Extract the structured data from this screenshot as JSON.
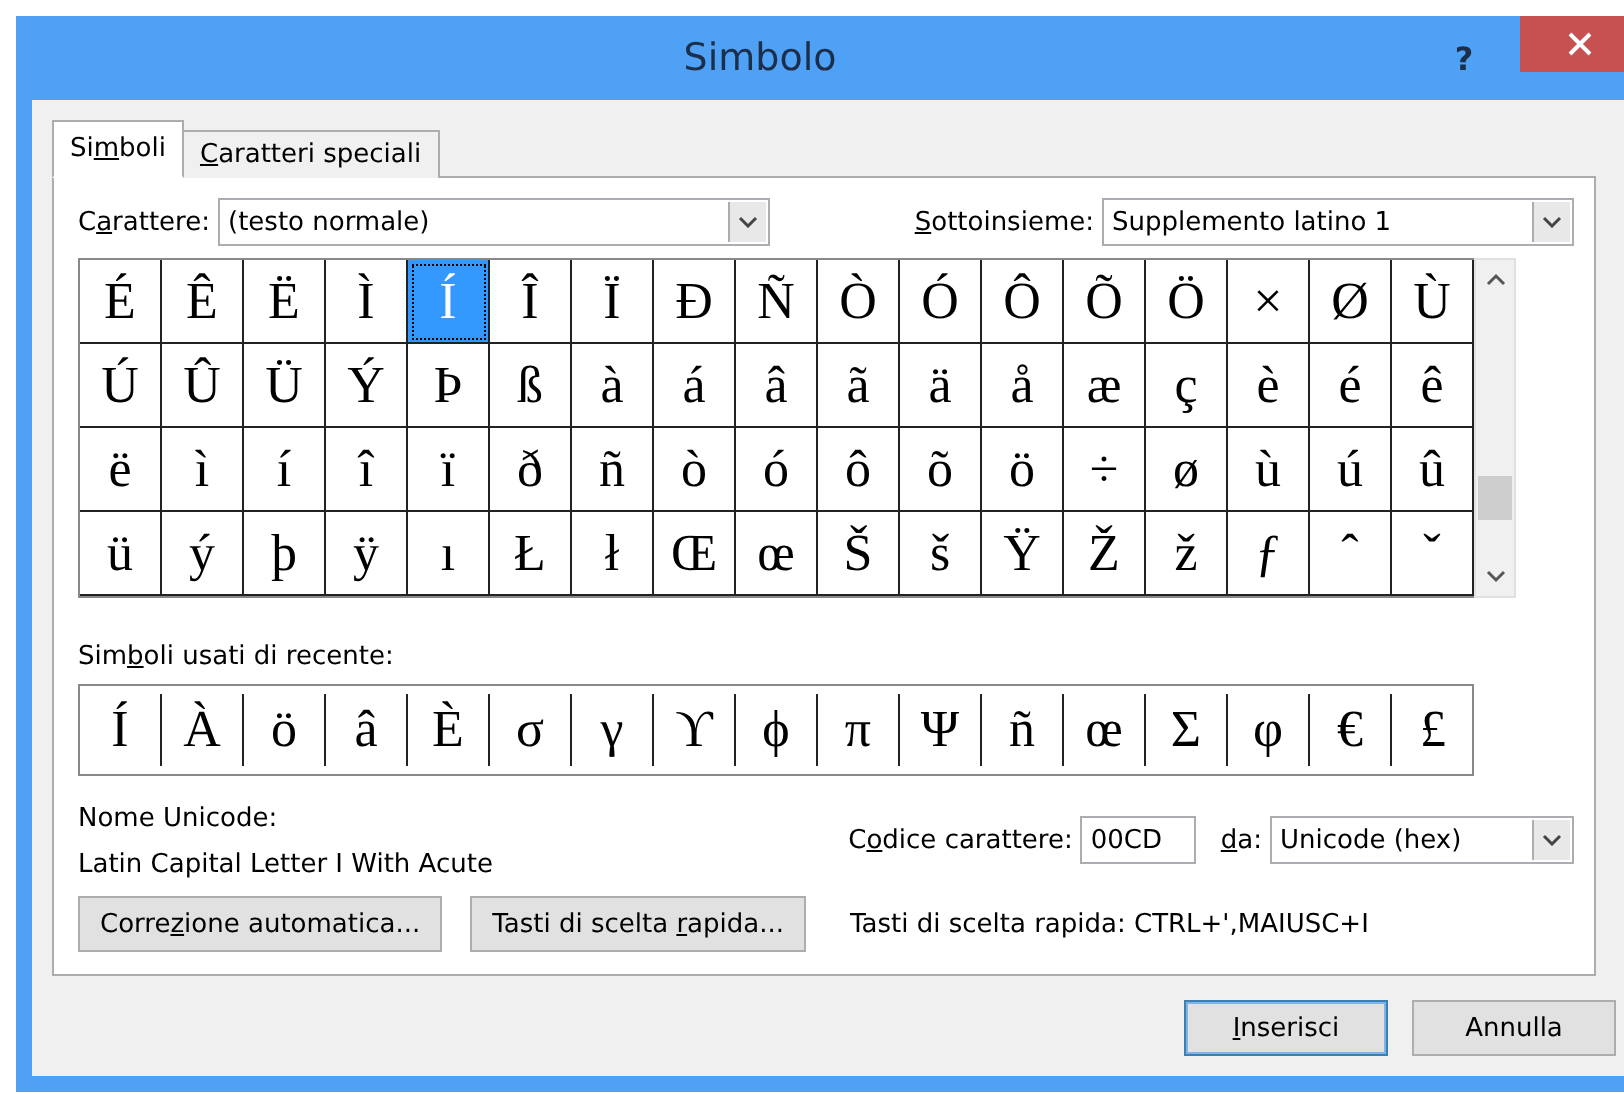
{
  "window": {
    "title": "Simbolo",
    "help_button": "?"
  },
  "tabs": [
    {
      "label": {
        "pre": "Si",
        "key": "m",
        "post": "boli"
      },
      "selected": true
    },
    {
      "label": {
        "key": "C",
        "post": "aratteri speciali"
      },
      "selected": false
    }
  ],
  "font_field": {
    "label": {
      "pre": "C",
      "key": "a",
      "post": "rattere:"
    },
    "value": "(testo normale)"
  },
  "subset_field": {
    "label": {
      "key": "S",
      "post": "ottoinsieme:"
    },
    "value": "Supplemento latino 1"
  },
  "symbol_grid": [
    [
      {
        "char": "É",
        "selected": false
      },
      {
        "char": "Ê",
        "selected": false
      },
      {
        "char": "Ë",
        "selected": false
      },
      {
        "char": "Ì",
        "selected": false
      },
      {
        "char": "Í",
        "selected": true
      },
      {
        "char": "Î",
        "selected": false
      },
      {
        "char": "Ï",
        "selected": false
      },
      {
        "char": "Ð",
        "selected": false
      },
      {
        "char": "Ñ",
        "selected": false
      },
      {
        "char": "Ò",
        "selected": false
      },
      {
        "char": "Ó",
        "selected": false
      },
      {
        "char": "Ô",
        "selected": false
      },
      {
        "char": "Õ",
        "selected": false
      },
      {
        "char": "Ö",
        "selected": false
      },
      {
        "char": "×",
        "selected": false
      },
      {
        "char": "Ø",
        "selected": false
      },
      {
        "char": "Ù",
        "selected": false
      }
    ],
    [
      {
        "char": "Ú",
        "selected": false
      },
      {
        "char": "Û",
        "selected": false
      },
      {
        "char": "Ü",
        "selected": false
      },
      {
        "char": "Ý",
        "selected": false
      },
      {
        "char": "Þ",
        "selected": false
      },
      {
        "char": "ß",
        "selected": false
      },
      {
        "char": "à",
        "selected": false
      },
      {
        "char": "á",
        "selected": false
      },
      {
        "char": "â",
        "selected": false
      },
      {
        "char": "ã",
        "selected": false
      },
      {
        "char": "ä",
        "selected": false
      },
      {
        "char": "å",
        "selected": false
      },
      {
        "char": "æ",
        "selected": false
      },
      {
        "char": "ç",
        "selected": false
      },
      {
        "char": "è",
        "selected": false
      },
      {
        "char": "é",
        "selected": false
      },
      {
        "char": "ê",
        "selected": false
      }
    ],
    [
      {
        "char": "ë",
        "selected": false
      },
      {
        "char": "ì",
        "selected": false
      },
      {
        "char": "í",
        "selected": false
      },
      {
        "char": "î",
        "selected": false
      },
      {
        "char": "ï",
        "selected": false
      },
      {
        "char": "ð",
        "selected": false
      },
      {
        "char": "ñ",
        "selected": false
      },
      {
        "char": "ò",
        "selected": false
      },
      {
        "char": "ó",
        "selected": false
      },
      {
        "char": "ô",
        "selected": false
      },
      {
        "char": "õ",
        "selected": false
      },
      {
        "char": "ö",
        "selected": false
      },
      {
        "char": "÷",
        "selected": false
      },
      {
        "char": "ø",
        "selected": false
      },
      {
        "char": "ù",
        "selected": false
      },
      {
        "char": "ú",
        "selected": false
      },
      {
        "char": "û",
        "selected": false
      }
    ],
    [
      {
        "char": "ü",
        "selected": false
      },
      {
        "char": "ý",
        "selected": false
      },
      {
        "char": "þ",
        "selected": false
      },
      {
        "char": "ÿ",
        "selected": false
      },
      {
        "char": "ı",
        "selected": false
      },
      {
        "char": "Ł",
        "selected": false
      },
      {
        "char": "ł",
        "selected": false
      },
      {
        "char": "Œ",
        "selected": false
      },
      {
        "char": "œ",
        "selected": false
      },
      {
        "char": "Š",
        "selected": false
      },
      {
        "char": "š",
        "selected": false
      },
      {
        "char": "Ÿ",
        "selected": false
      },
      {
        "char": "Ž",
        "selected": false
      },
      {
        "char": "ž",
        "selected": false
      },
      {
        "char": "ƒ",
        "selected": false
      },
      {
        "char": "ˆ",
        "selected": false
      },
      {
        "char": "ˇ",
        "selected": false
      }
    ]
  ],
  "recent": {
    "label": {
      "pre": "Sim",
      "key": "b",
      "post": "oli usati di recente:"
    },
    "symbols": [
      "Í",
      "À",
      "ö",
      "â",
      "È",
      "σ",
      "γ",
      "ϒ",
      "ϕ",
      "π",
      "Ψ",
      "ñ",
      "œ",
      "Σ",
      "φ",
      "€",
      "£"
    ]
  },
  "unicode_name": {
    "label": "Nome Unicode:",
    "value": "Latin Capital Letter I With Acute"
  },
  "char_code": {
    "label": {
      "pre": "C",
      "key": "o",
      "post": "dice carattere:"
    },
    "value": "00CD"
  },
  "from_field": {
    "label": {
      "key": "d",
      "post": "a:"
    },
    "value": "Unicode (hex)"
  },
  "action_buttons": [
    {
      "label": {
        "pre": "Corre",
        "key": "z",
        "post": "ione automatica..."
      }
    },
    {
      "label": {
        "pre": "Tasti di scelta ",
        "key": "r",
        "post": "apida..."
      }
    }
  ],
  "shortcut_text": "Tasti di scelta rapida: CTRL+',MAIUSC+I",
  "footer_buttons": [
    {
      "label": {
        "key": "I",
        "post": "nserisci"
      },
      "focused": true
    },
    {
      "label": {
        "post": "Annulla"
      },
      "focused": false
    }
  ]
}
